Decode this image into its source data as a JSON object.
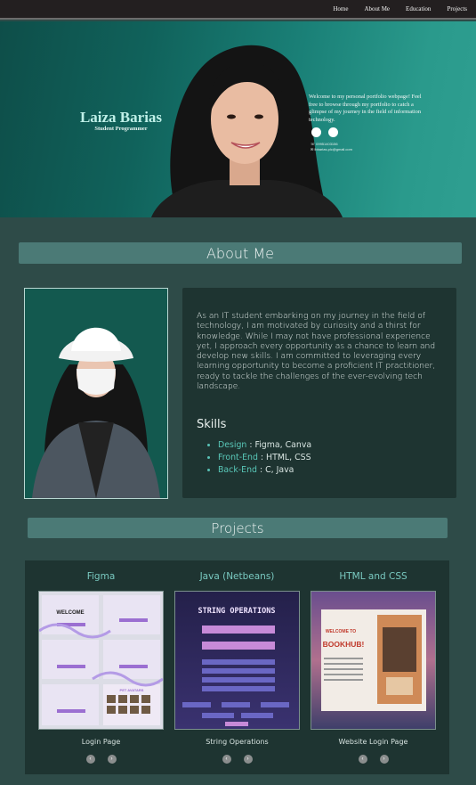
{
  "nav": {
    "items": [
      {
        "label": "Home"
      },
      {
        "label": "About Me"
      },
      {
        "label": "Education"
      },
      {
        "label": "Projects"
      }
    ]
  },
  "hero": {
    "name": "Laiza Barias",
    "role": "Student Programmer",
    "welcome": "Welcome to my personal portfolio webpage! Feel free to browse through my portfolio to catch a glimpse of my journey in the field of information technology.",
    "icons": [
      "facebook-icon",
      "github-icon"
    ],
    "phone": "09951403156",
    "email": "lbbarias.plc@gmail.com"
  },
  "about": {
    "title": "About Me",
    "paragraph": "As an IT student embarking on my journey in the field of technology, I am motivated by curiosity and a thirst for knowledge. While I may not have professional experience yet, I approach every opportunity as a chance to learn and develop new skills. I am committed to leveraging every learning opportunity to become a proficient IT practitioner, ready to tackle the challenges of the ever-evolving tech landscape.",
    "skills_title": "Skills",
    "skills": [
      {
        "name": "Design",
        "value": " : Figma, Canva"
      },
      {
        "name": "Front-End",
        "value": " : HTML, CSS"
      },
      {
        "name": "Back-End",
        "value": " : C, Java"
      }
    ]
  },
  "projects": {
    "title": "Projects",
    "items": [
      {
        "title": "Figma",
        "caption": "Login Page",
        "thumb_welcome": "WELCOME",
        "thumb_avatar": "PET AVATARS"
      },
      {
        "title": "Java (Netbeans)",
        "caption": "String Operations",
        "thumb_heading": "STRING OPERATIONS"
      },
      {
        "title": "HTML and CSS",
        "caption": "Website Login Page",
        "thumb_welcome": "WELCOME TO",
        "thumb_brand": "BOOKHUB!"
      }
    ],
    "prev_symbol": "‹",
    "next_symbol": "›"
  },
  "colors": {
    "page_bg": "#2e4b48",
    "nav_bg": "#231f20",
    "header_bg": "#4b7a76",
    "card_bg": "#1e3431",
    "accent": "#59c7b8"
  }
}
